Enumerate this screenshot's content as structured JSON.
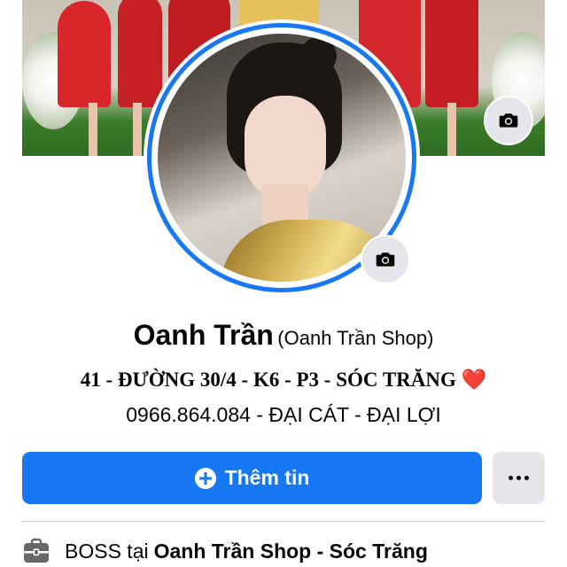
{
  "profile": {
    "name": "Oanh Trần",
    "alternate_name": "(Oanh Trần Shop)",
    "bio_line1": "41 - ĐƯỜNG 30/4 - K6 - P3 - SÓC TRĂNG",
    "bio_heart": "❤️",
    "bio_line2": "0966.864.084 - ĐẠI CÁT - ĐẠI LỢI"
  },
  "actions": {
    "add_info_label": "Thêm tin",
    "more_label": "..."
  },
  "work": {
    "prefix": "BOSS tại ",
    "place": "Oanh Trần Shop - Sóc Trăng"
  },
  "colors": {
    "accent": "#1877f2",
    "secondary_button": "#e4e6eb",
    "heart": "#e02424"
  },
  "icons": {
    "cover_camera": "camera-icon",
    "avatar_camera": "camera-icon",
    "add_info": "plus-circle-icon",
    "more": "more-dots-icon",
    "work": "briefcase-icon"
  }
}
